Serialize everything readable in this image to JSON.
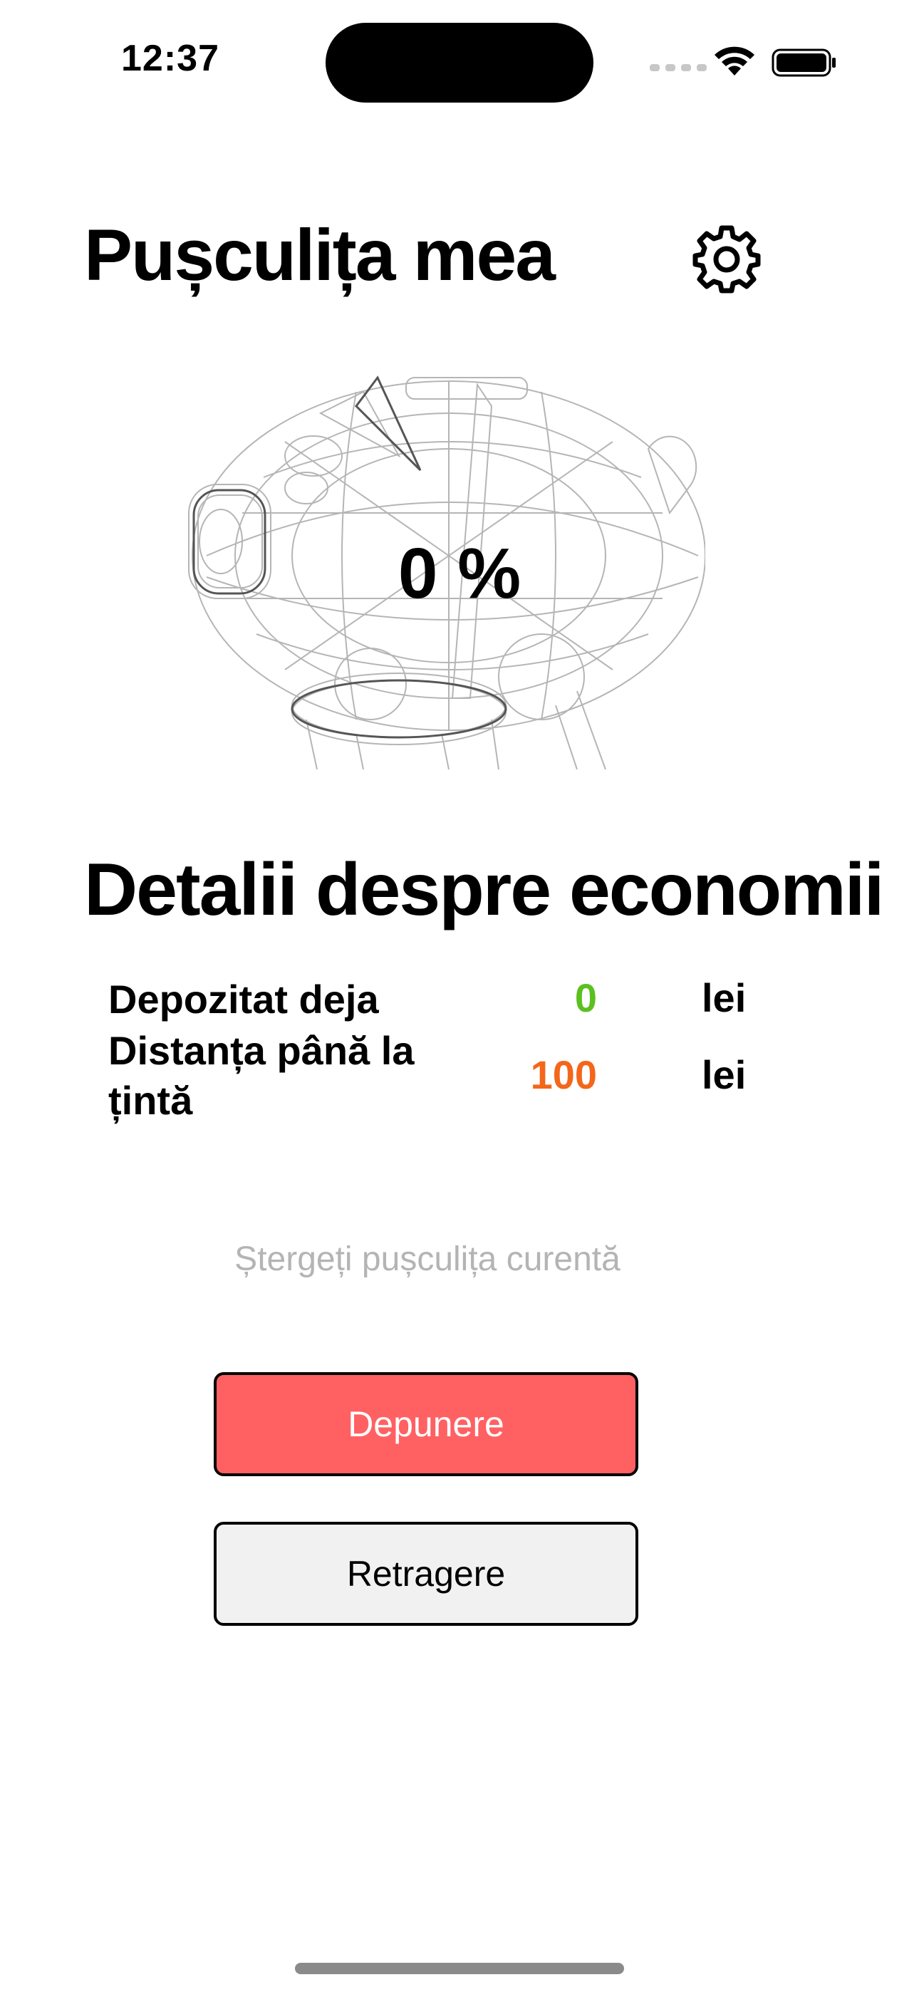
{
  "status_bar": {
    "time": "12:37"
  },
  "header": {
    "title": "Pușculița mea",
    "settings_icon": "gear-icon"
  },
  "piggy": {
    "progress_text": "0 %",
    "progress_fraction": 0
  },
  "details": {
    "title": "Detalii despre economii",
    "rows": [
      {
        "label": "Depozitat deja",
        "value": "0",
        "unit": "lei",
        "value_color": "#5cc01f"
      },
      {
        "label": "Distanța până la țintă",
        "value": "100",
        "unit": "lei",
        "value_color": "#f4661a"
      }
    ]
  },
  "actions": {
    "delete_label": "Ștergeți pușculița curentă",
    "deposit_label": "Depunere",
    "withdraw_label": "Retragere"
  },
  "colors": {
    "deposit_button": "#ff6163",
    "withdraw_button": "#f1f1f1",
    "delete_link": "#b4b4b4"
  }
}
